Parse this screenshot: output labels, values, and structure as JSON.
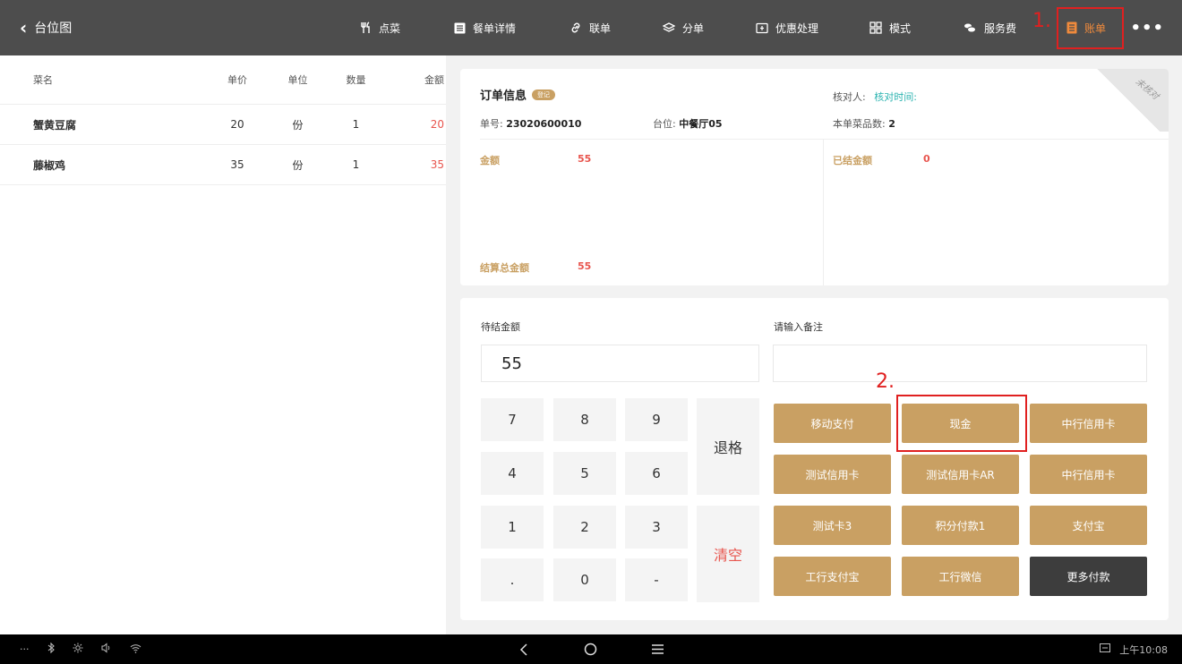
{
  "header": {
    "back_label": "台位图",
    "buttons": [
      {
        "label": "点菜",
        "icon": "fork-knife-icon"
      },
      {
        "label": "餐单详情",
        "icon": "list-icon"
      },
      {
        "label": "联单",
        "icon": "link-icon"
      },
      {
        "label": "分单",
        "icon": "layers-icon"
      },
      {
        "label": "优惠处理",
        "icon": "coupon-icon"
      },
      {
        "label": "模式",
        "icon": "grid-icon"
      },
      {
        "label": "服务费",
        "icon": "coins-icon"
      },
      {
        "label": "账单",
        "icon": "bill-icon"
      }
    ],
    "more": "•••",
    "active_color": "#f08a3c"
  },
  "annotations": {
    "step1": "1.",
    "step2": "2."
  },
  "dish_list": {
    "columns": [
      "菜名",
      "单价",
      "单位",
      "数量",
      "金额"
    ],
    "rows": [
      {
        "name": "蟹黄豆腐",
        "price": "20",
        "unit": "份",
        "qty": "1",
        "amount": "20"
      },
      {
        "name": "藤椒鸡",
        "price": "35",
        "unit": "份",
        "qty": "1",
        "amount": "35"
      }
    ]
  },
  "order": {
    "title": "订单信息",
    "badge": "登记",
    "checker_label": "核对人:",
    "check_time_label": "核对时间:",
    "order_no_label": "单号:",
    "order_no": "23020600010",
    "table_label": "台位:",
    "table": "中餐厅05",
    "dish_count_label": "本单菜品数:",
    "dish_count": "2",
    "amount_label": "金额",
    "amount": "55",
    "settled_label": "已结金额",
    "settled": "0",
    "total_label": "结算总金额",
    "total": "55",
    "corner_stamp": "未核对"
  },
  "payment": {
    "pending_label": "待结金额",
    "pending_value": "55",
    "remark_label": "请输入备注",
    "keys": [
      "7",
      "8",
      "9",
      "4",
      "5",
      "6",
      "1",
      "2",
      "3",
      ".",
      "0",
      "-"
    ],
    "backspace": "退格",
    "clear": "清空",
    "methods": [
      "移动支付",
      "现金",
      "中行信用卡",
      "测试信用卡",
      "测试信用卡AR",
      "中行信用卡",
      "测试卡3",
      "积分付款1",
      "支付宝",
      "工行支付宝",
      "工行微信",
      "更多付款"
    ],
    "gold_color": "#c9a063"
  },
  "system_bar": {
    "time": "上午10:08",
    "left_icons": [
      "···",
      "bluetooth-icon",
      "brightness-icon",
      "volume-icon",
      "wifi-icon"
    ]
  }
}
